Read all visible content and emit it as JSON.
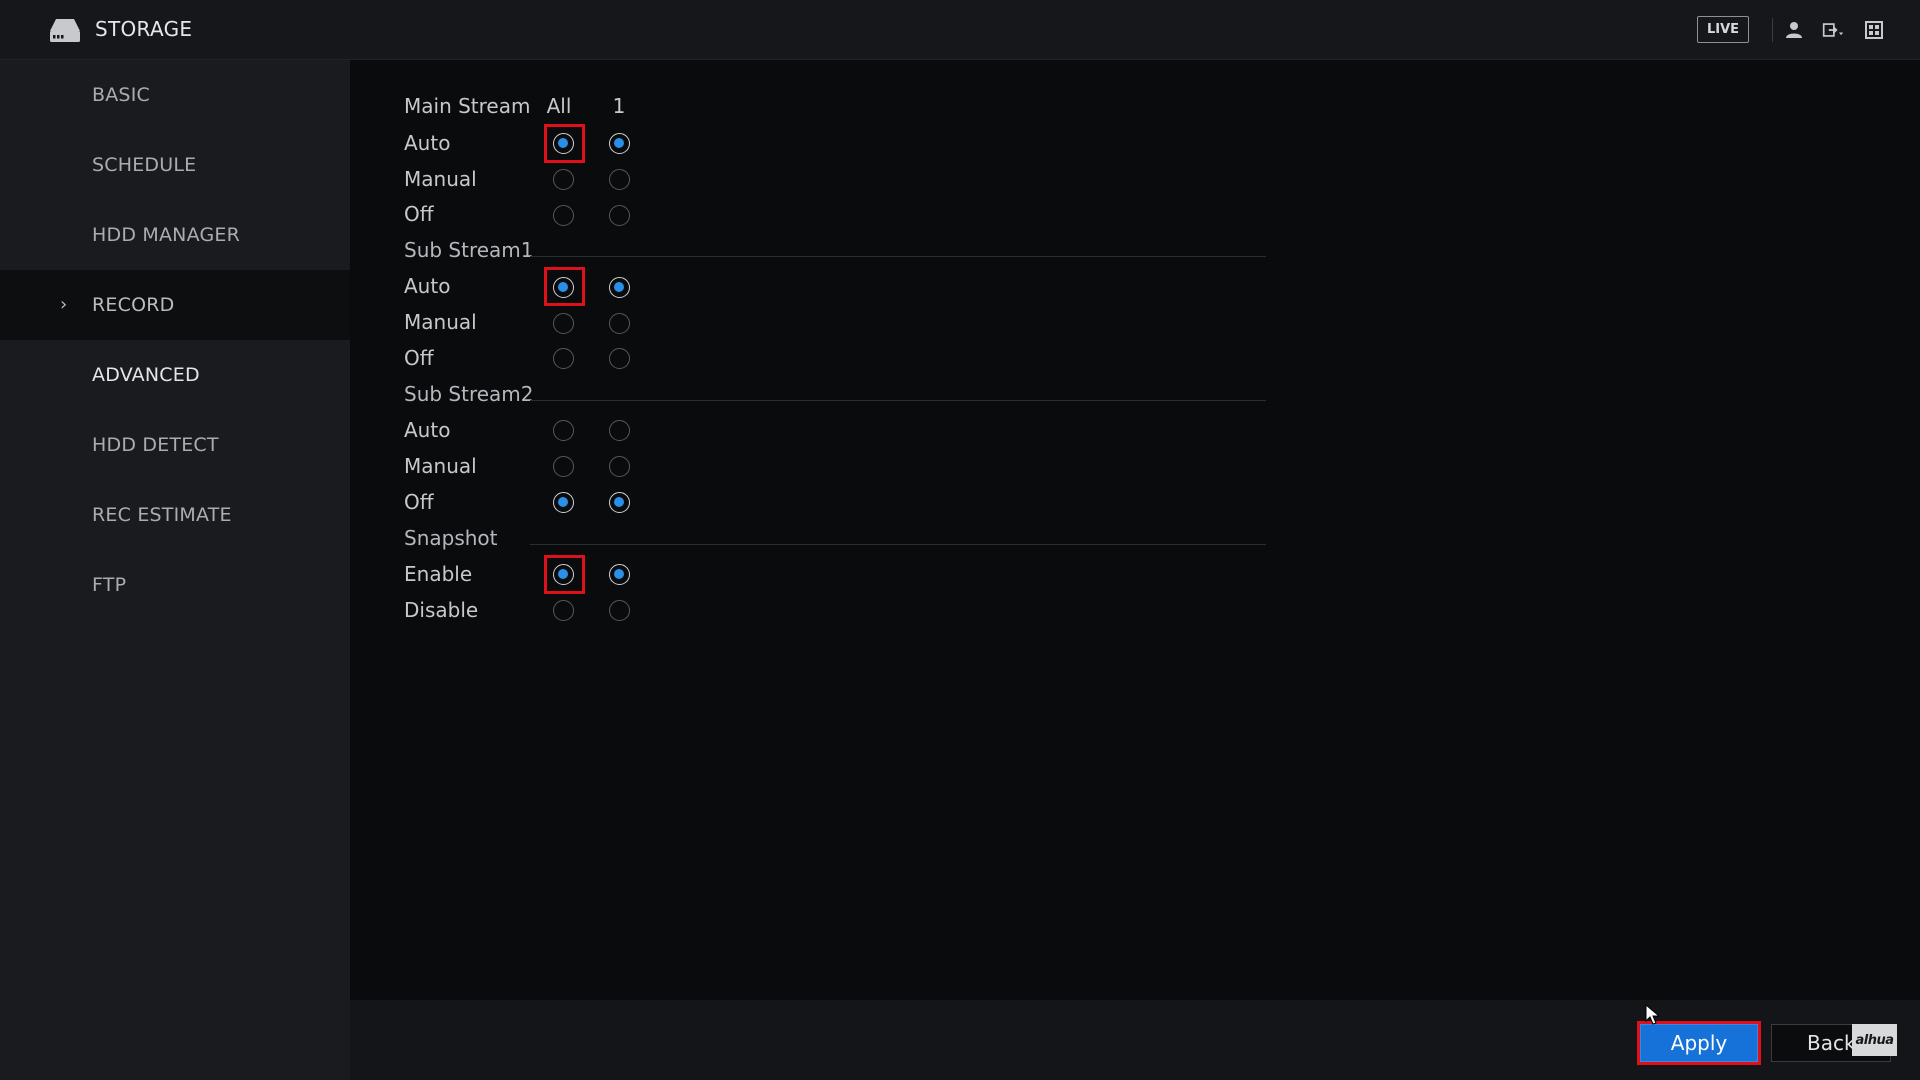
{
  "header": {
    "title": "STORAGE",
    "live_label": "LIVE",
    "icons": [
      "hdd-icon",
      "user-icon",
      "exit-icon",
      "grid-icon"
    ]
  },
  "sidebar": {
    "items": [
      {
        "label": "BASIC"
      },
      {
        "label": "SCHEDULE"
      },
      {
        "label": "HDD MANAGER"
      },
      {
        "label": "RECORD",
        "active": true
      },
      {
        "label": "ADVANCED"
      },
      {
        "label": "HDD DETECT"
      },
      {
        "label": "REC ESTIMATE"
      },
      {
        "label": "FTP"
      }
    ]
  },
  "record": {
    "columns": [
      "All",
      "1"
    ],
    "main_stream": {
      "label": "Main Stream",
      "options": [
        "Auto",
        "Manual",
        "Off"
      ],
      "selected": "Auto"
    },
    "sub_stream1": {
      "label": "Sub Stream1",
      "options": [
        "Auto",
        "Manual",
        "Off"
      ],
      "selected": "Auto"
    },
    "sub_stream2": {
      "label": "Sub Stream2",
      "options": [
        "Auto",
        "Manual",
        "Off"
      ],
      "selected": "Off"
    },
    "snapshot": {
      "label": "Snapshot",
      "options": [
        "Enable",
        "Disable"
      ],
      "selected": "Enable"
    }
  },
  "footer": {
    "apply_label": "Apply",
    "back_label": "Back",
    "brand": "alhua"
  },
  "colors": {
    "accent": "#1671d8",
    "radio_fill": "#2a8fe6",
    "highlight": "#e0101a"
  }
}
